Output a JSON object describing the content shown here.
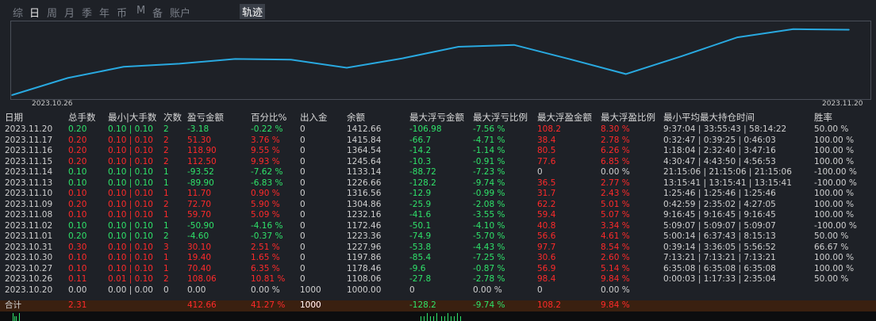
{
  "tabs": [
    {
      "label": "综",
      "active": false
    },
    {
      "label": "日",
      "active": true
    },
    {
      "label": "周",
      "active": false
    },
    {
      "label": "月",
      "active": false
    },
    {
      "label": "季",
      "active": false
    },
    {
      "label": "年",
      "active": false
    },
    {
      "label": "币",
      "active": false
    },
    {
      "label": "M",
      "active": false
    },
    {
      "label": "备",
      "active": false
    },
    {
      "label": "账户",
      "active": false
    }
  ],
  "trajectory_tab": "轨迹",
  "chart_data": {
    "type": "line",
    "x": [
      "2023.10.20",
      "2023.10.26",
      "2023.10.27",
      "2023.10.30",
      "2023.10.31",
      "2023.11.01",
      "2023.11.02",
      "2023.11.08",
      "2023.11.09",
      "2023.11.10",
      "2023.11.13",
      "2023.11.14",
      "2023.11.15",
      "2023.11.16",
      "2023.11.17",
      "2023.11.20"
    ],
    "values": [
      1000.0,
      1108.06,
      1178.46,
      1197.86,
      1227.96,
      1223.36,
      1172.46,
      1232.16,
      1304.86,
      1316.56,
      1226.66,
      1133.14,
      1245.64,
      1364.54,
      1415.84,
      1412.66
    ],
    "x_start_label": "2023.10.26",
    "x_end_label": "2023.11.20",
    "color": "#29a9e0"
  },
  "headers": [
    "日期",
    "总手数",
    "最小|大手数",
    "次数",
    "盈亏金额",
    "百分比%",
    "出入金",
    "余额",
    "最大浮亏金额",
    "最大浮亏比例",
    "最大浮盈金额",
    "最大浮盈比例",
    "最小平均最大持仓时间",
    "胜率"
  ],
  "rows": [
    {
      "date": "2023.11.20",
      "lots": "0.20",
      "minmax": "0.10 | 0.10",
      "count": "2",
      "pnl": "-3.18",
      "pct": "-0.22 %",
      "io": "0",
      "bal": "1412.66",
      "mfl": "-106.98",
      "mflp": "-7.56 %",
      "mfp": "108.2",
      "mfpp": "8.30 %",
      "hold": "9:37:04 | 33:55:43 | 58:14:22",
      "win": "50.00 %",
      "c": "g"
    },
    {
      "date": "2023.11.17",
      "lots": "0.20",
      "minmax": "0.10 | 0.10",
      "count": "2",
      "pnl": "51.30",
      "pct": "3.76 %",
      "io": "0",
      "bal": "1415.84",
      "mfl": "-66.7",
      "mflp": "-4.71 %",
      "mfp": "38.4",
      "mfpp": "2.78 %",
      "hold": "0:32:47 | 0:39:25 | 0:46:03",
      "win": "100.00 %",
      "c": "r"
    },
    {
      "date": "2023.11.16",
      "lots": "0.20",
      "minmax": "0.10 | 0.10",
      "count": "2",
      "pnl": "118.90",
      "pct": "9.55 %",
      "io": "0",
      "bal": "1364.54",
      "mfl": "-14.2",
      "mflp": "-1.14 %",
      "mfp": "80.5",
      "mfpp": "6.26 %",
      "hold": "1:18:04 | 2:32:40 | 3:47:16",
      "win": "100.00 %",
      "c": "r"
    },
    {
      "date": "2023.11.15",
      "lots": "0.20",
      "minmax": "0.10 | 0.10",
      "count": "2",
      "pnl": "112.50",
      "pct": "9.93 %",
      "io": "0",
      "bal": "1245.64",
      "mfl": "-10.3",
      "mflp": "-0.91 %",
      "mfp": "77.6",
      "mfpp": "6.85 %",
      "hold": "4:30:47 | 4:43:50 | 4:56:53",
      "win": "100.00 %",
      "c": "r"
    },
    {
      "date": "2023.11.14",
      "lots": "0.10",
      "minmax": "0.10 | 0.10",
      "count": "1",
      "pnl": "-93.52",
      "pct": "-7.62 %",
      "io": "0",
      "bal": "1133.14",
      "mfl": "-88.72",
      "mflp": "-7.23 %",
      "mfp": "0",
      "mfpp": "0.00 %",
      "hold": "21:15:06 | 21:15:06 | 21:15:06",
      "win": "-100.00 %",
      "c": "g"
    },
    {
      "date": "2023.11.13",
      "lots": "0.10",
      "minmax": "0.10 | 0.10",
      "count": "1",
      "pnl": "-89.90",
      "pct": "-6.83 %",
      "io": "0",
      "bal": "1226.66",
      "mfl": "-128.2",
      "mflp": "-9.74 %",
      "mfp": "36.5",
      "mfpp": "2.77 %",
      "hold": "13:15:41 | 13:15:41 | 13:15:41",
      "win": "-100.00 %",
      "c": "g"
    },
    {
      "date": "2023.11.10",
      "lots": "0.10",
      "minmax": "0.10 | 0.10",
      "count": "1",
      "pnl": "11.70",
      "pct": "0.90 %",
      "io": "0",
      "bal": "1316.56",
      "mfl": "-12.9",
      "mflp": "-0.99 %",
      "mfp": "31.7",
      "mfpp": "2.43 %",
      "hold": "1:25:46 | 1:25:46 | 1:25:46",
      "win": "100.00 %",
      "c": "r"
    },
    {
      "date": "2023.11.09",
      "lots": "0.20",
      "minmax": "0.10 | 0.10",
      "count": "2",
      "pnl": "72.70",
      "pct": "5.90 %",
      "io": "0",
      "bal": "1304.86",
      "mfl": "-25.9",
      "mflp": "-2.08 %",
      "mfp": "62.2",
      "mfpp": "5.01 %",
      "hold": "0:42:59 | 2:35:02 | 4:27:05",
      "win": "100.00 %",
      "c": "r"
    },
    {
      "date": "2023.11.08",
      "lots": "0.10",
      "minmax": "0.10 | 0.10",
      "count": "1",
      "pnl": "59.70",
      "pct": "5.09 %",
      "io": "0",
      "bal": "1232.16",
      "mfl": "-41.6",
      "mflp": "-3.55 %",
      "mfp": "59.4",
      "mfpp": "5.07 %",
      "hold": "9:16:45 | 9:16:45 | 9:16:45",
      "win": "100.00 %",
      "c": "r"
    },
    {
      "date": "2023.11.02",
      "lots": "0.10",
      "minmax": "0.10 | 0.10",
      "count": "1",
      "pnl": "-50.90",
      "pct": "-4.16 %",
      "io": "0",
      "bal": "1172.46",
      "mfl": "-50.1",
      "mflp": "-4.10 %",
      "mfp": "40.8",
      "mfpp": "3.34 %",
      "hold": "5:09:07 | 5:09:07 | 5:09:07",
      "win": "-100.00 %",
      "c": "g"
    },
    {
      "date": "2023.11.01",
      "lots": "0.20",
      "minmax": "0.10 | 0.10",
      "count": "2",
      "pnl": "-4.60",
      "pct": "-0.37 %",
      "io": "0",
      "bal": "1223.36",
      "mfl": "-74.9",
      "mflp": "-5.70 %",
      "mfp": "56.6",
      "mfpp": "4.61 %",
      "hold": "5:00:14 | 6:37:43 | 8:15:13",
      "win": "50.00 %",
      "c": "g"
    },
    {
      "date": "2023.10.31",
      "lots": "0.30",
      "minmax": "0.10 | 0.10",
      "count": "3",
      "pnl": "30.10",
      "pct": "2.51 %",
      "io": "0",
      "bal": "1227.96",
      "mfl": "-53.8",
      "mflp": "-4.43 %",
      "mfp": "97.7",
      "mfpp": "8.54 %",
      "hold": "0:39:14 | 3:36:05 | 5:56:52",
      "win": "66.67 %",
      "c": "r"
    },
    {
      "date": "2023.10.30",
      "lots": "0.10",
      "minmax": "0.10 | 0.10",
      "count": "1",
      "pnl": "19.40",
      "pct": "1.65 %",
      "io": "0",
      "bal": "1197.86",
      "mfl": "-85.4",
      "mflp": "-7.25 %",
      "mfp": "30.6",
      "mfpp": "2.60 %",
      "hold": "7:13:21 | 7:13:21 | 7:13:21",
      "win": "100.00 %",
      "c": "r"
    },
    {
      "date": "2023.10.27",
      "lots": "0.10",
      "minmax": "0.10 | 0.10",
      "count": "1",
      "pnl": "70.40",
      "pct": "6.35 %",
      "io": "0",
      "bal": "1178.46",
      "mfl": "-9.6",
      "mflp": "-0.87 %",
      "mfp": "56.9",
      "mfpp": "5.14 %",
      "hold": "6:35:08 | 6:35:08 | 6:35:08",
      "win": "100.00 %",
      "c": "r"
    },
    {
      "date": "2023.10.26",
      "lots": "0.11",
      "minmax": "0.01 | 0.10",
      "count": "2",
      "pnl": "108.06",
      "pct": "10.81 %",
      "io": "0",
      "bal": "1108.06",
      "mfl": "-27.8",
      "mflp": "-2.78 %",
      "mfp": "98.4",
      "mfpp": "9.84 %",
      "hold": "0:00:03 | 1:17:33 | 2:35:04",
      "win": "50.00 %",
      "c": "r"
    },
    {
      "date": "2023.10.20",
      "lots": "0.00",
      "minmax": "0.00 | 0.00",
      "count": "0",
      "pnl": "0.00",
      "pct": "0.00 %",
      "io": "1000",
      "bal": "1000.00",
      "mfl": "0",
      "mflp": "0.00 %",
      "mfp": "0",
      "mfpp": "0.00 %",
      "hold": "",
      "win": "",
      "c": "w"
    }
  ],
  "total": {
    "label": "合计",
    "lots": "2.31",
    "pnl": "412.66",
    "pct": "41.27 %",
    "io": "1000",
    "io2": "1000",
    "mfl": "-128.2",
    "mflp": "-9.74 %",
    "mfp": "108.2",
    "mfpp": "9.84 %"
  }
}
